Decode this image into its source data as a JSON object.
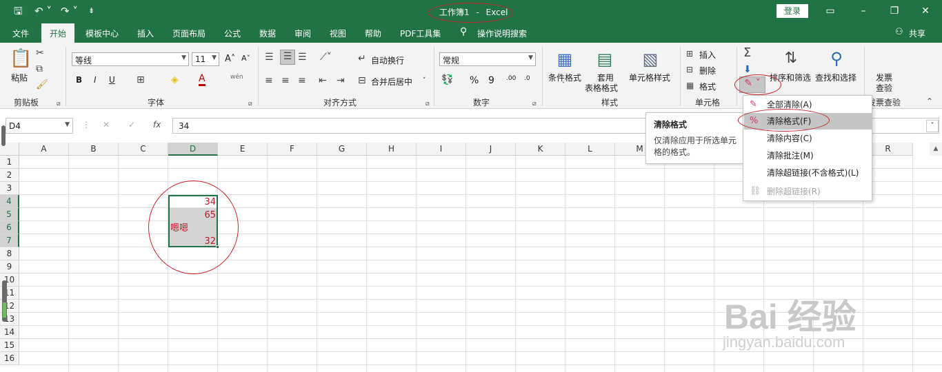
{
  "title": {
    "workbook": "工作簿1",
    "separator": "-",
    "app": "Excel",
    "login": "登录",
    "qa_save": "🖫",
    "qa_undo": "↶ ˅",
    "qa_redo": "↷ ˅",
    "qa_more": "⇟"
  },
  "menu_tabs": [
    "文件",
    "开始",
    "模板中心",
    "插入",
    "页面布局",
    "公式",
    "数据",
    "审阅",
    "视图",
    "帮助",
    "PDF工具集",
    "操作说明搜索"
  ],
  "share": "共享",
  "ribbon": {
    "clipboard": {
      "paste": "粘贴",
      "label": "剪贴板"
    },
    "font": {
      "name": "等线",
      "size": "11",
      "bold": "B",
      "italic": "I",
      "underline": "U",
      "grow": "A˄",
      "shrink": "A˅",
      "color": "A",
      "phonetic": "wén",
      "label": "字体"
    },
    "alignment": {
      "wrap": "自动换行",
      "merge": "合并后居中",
      "label": "对齐方式"
    },
    "number": {
      "format": "常规",
      "percent": "%",
      "comma": "9",
      "inc_dec": ".00",
      "dec_dec": ".0",
      "label": "数字"
    },
    "styles": {
      "conditional": "条件格式",
      "table1": "套用",
      "table2": "表格格式",
      "cell_style": "单元格样式",
      "label": "样式"
    },
    "cells": {
      "insert": "插入",
      "delete": "删除",
      "format": "格式",
      "label": "单元格"
    },
    "editing": {
      "sort": "排序和筛选",
      "find": "查找和选择",
      "label": "编辑"
    },
    "invoice": {
      "line1": "发票",
      "line2": "查验",
      "label": "发票查验"
    }
  },
  "formula_bar": {
    "name_box": "D4",
    "cancel": "✕",
    "enter": "✓",
    "fx": "fx",
    "value": "34"
  },
  "columns": [
    "A",
    "B",
    "C",
    "D",
    "E",
    "F",
    "G",
    "H",
    "I",
    "J",
    "K",
    "L",
    "M",
    "N",
    "O",
    "P",
    "Q",
    "R"
  ],
  "rows": [
    "1",
    "2",
    "3",
    "4",
    "5",
    "6",
    "7",
    "8",
    "9",
    "10",
    "11",
    "12",
    "13",
    "14",
    "15",
    "16"
  ],
  "selected_column": "D",
  "cells": {
    "D4": "34",
    "D5": "65",
    "D6": "嗯嗯",
    "D7": "32"
  },
  "tooltip": {
    "title": "清除格式",
    "body_line1": "仅清除应用于所选单元",
    "body_line2": "格的格式。"
  },
  "clear_menu": [
    {
      "label": "全部清除(A)",
      "icon": "eraser-icon"
    },
    {
      "label": "清除格式(F)",
      "icon": "clear-format-icon",
      "highlighted": true
    },
    {
      "label": "清除内容(C)",
      "icon": ""
    },
    {
      "label": "清除批注(M)",
      "icon": ""
    },
    {
      "label": "清除超链接(不含格式)(L)",
      "icon": ""
    },
    {
      "label": "删除超链接(R)",
      "icon": "unlink-icon",
      "disabled": true
    }
  ],
  "watermark": {
    "brand": "Bai 经验",
    "url": "jingyan.baidu.com"
  },
  "colors": {
    "accent": "#217346",
    "annotation": "#c8232c",
    "cell_text": "#c0151e"
  }
}
